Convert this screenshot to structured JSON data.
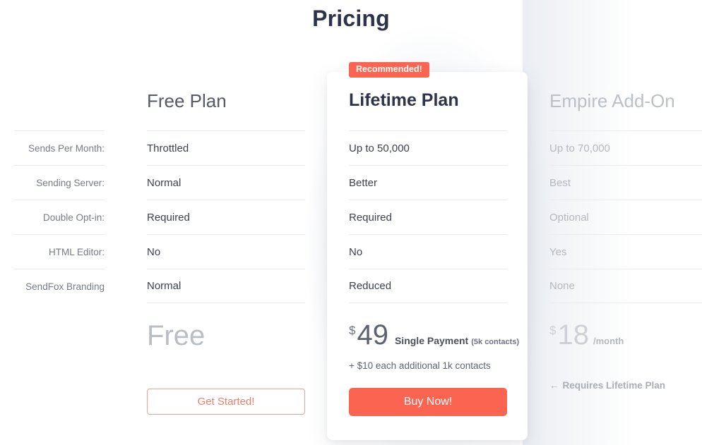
{
  "page": {
    "title": "Pricing",
    "accent_color": "#fb6450",
    "title_color": "#2d3349",
    "muted_color": "#b4b8bf"
  },
  "feature_labels": [
    "Sends Per Month:",
    "Sending Server:",
    "Double Opt-in:",
    "HTML Editor:",
    "SendFox Branding"
  ],
  "plans": {
    "free": {
      "name": "Free Plan",
      "values": [
        "Throttled",
        "Normal",
        "Required",
        "No",
        "Normal"
      ],
      "price": "Free",
      "cta": "Get Started!"
    },
    "lifetime": {
      "badge": "Recommended!",
      "name": "Lifetime Plan",
      "values": [
        "Up to 50,000",
        "Better",
        "Required",
        "No",
        "Reduced"
      ],
      "currency": "$",
      "amount": "49",
      "period": "Single Payment",
      "period_note": "(5k contacts)",
      "fineprint": "+ $10 each additional 1k contacts",
      "cta": "Buy Now!"
    },
    "empire": {
      "name": "Empire Add-On",
      "values": [
        "Up to 70,000",
        "Best",
        "Optional",
        "Yes",
        "None"
      ],
      "currency": "$",
      "amount": "18",
      "period": "/month",
      "requires_arrow": "←",
      "requires_note": "Requires Lifetime Plan"
    }
  }
}
